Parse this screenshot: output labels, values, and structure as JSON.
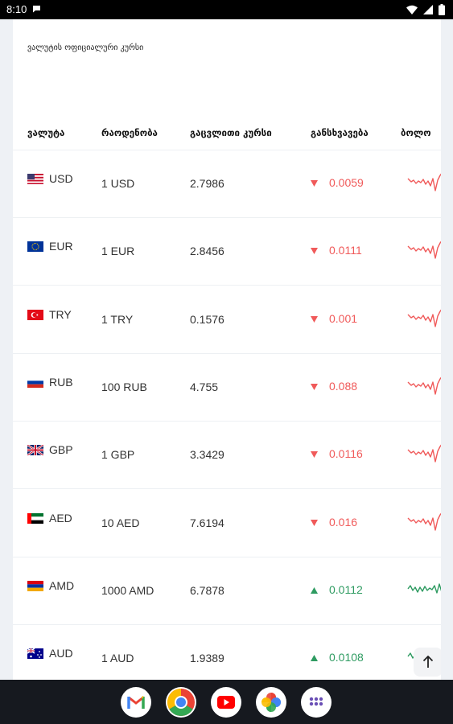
{
  "status_bar": {
    "time": "8:10"
  },
  "page": {
    "title": "ვალუტის ოფიციალური კურსი",
    "columns": [
      "ვალუტა",
      "რაოდენობა",
      "გაცვლითი კურსი",
      "განსხვავება",
      "ბოლო"
    ]
  },
  "rates": [
    {
      "code": "USD",
      "amount": "1 USD",
      "rate": "2.7986",
      "diff": "0.0059",
      "direction": "down",
      "flag": "us-flag-icon"
    },
    {
      "code": "EUR",
      "amount": "1 EUR",
      "rate": "2.8456",
      "diff": "0.0111",
      "direction": "down",
      "flag": "eu-flag-icon"
    },
    {
      "code": "TRY",
      "amount": "1 TRY",
      "rate": "0.1576",
      "diff": "0.001",
      "direction": "down",
      "flag": "tr-flag-icon"
    },
    {
      "code": "RUB",
      "amount": "100 RUB",
      "rate": "4.755",
      "diff": "0.088",
      "direction": "down",
      "flag": "ru-flag-icon"
    },
    {
      "code": "GBP",
      "amount": "1 GBP",
      "rate": "3.3429",
      "diff": "0.0116",
      "direction": "down",
      "flag": "gb-flag-icon"
    },
    {
      "code": "AED",
      "amount": "10 AED",
      "rate": "7.6194",
      "diff": "0.016",
      "direction": "down",
      "flag": "ae-flag-icon"
    },
    {
      "code": "AMD",
      "amount": "1000 AMD",
      "rate": "6.7878",
      "diff": "0.0112",
      "direction": "up",
      "flag": "am-flag-icon"
    },
    {
      "code": "AUD",
      "amount": "1 AUD",
      "rate": "1.9389",
      "diff": "0.0108",
      "direction": "up",
      "flag": "au-flag-icon"
    }
  ],
  "colors": {
    "down": "#f05a5a",
    "up": "#2e9b61"
  },
  "dock": [
    "gmail-icon",
    "chrome-icon",
    "youtube-icon",
    "photos-icon",
    "app-drawer-icon"
  ]
}
